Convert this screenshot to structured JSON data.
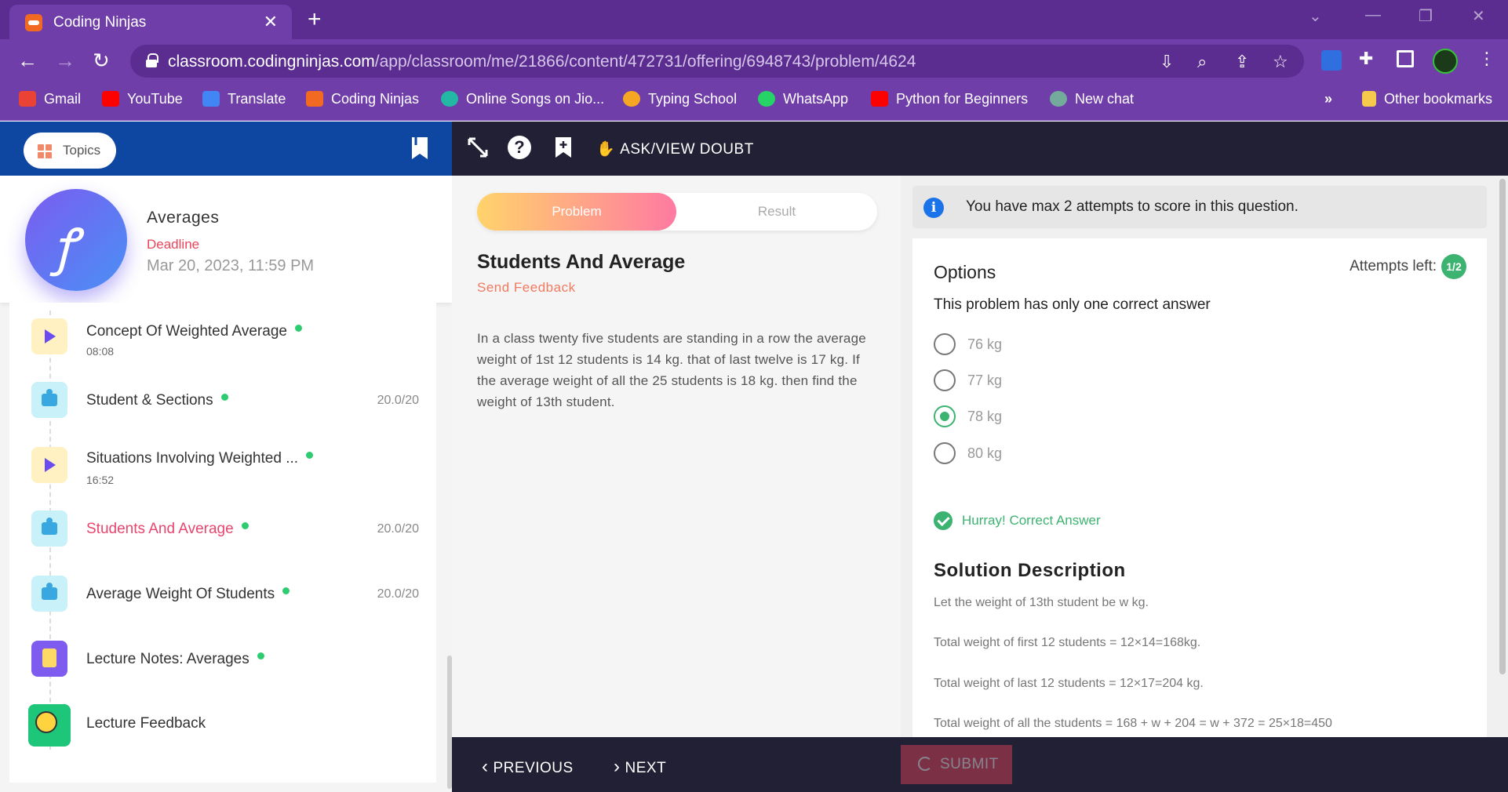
{
  "browser": {
    "tab_title": "Coding Ninjas",
    "tab_close": "✕",
    "new_tab": "+",
    "url_domain": "classroom.codingninjas.com",
    "url_path": "/app/classroom/me/21866/content/472731/offering/6948743/problem/4624",
    "bookmarks": [
      {
        "label": "Gmail",
        "color": "#ea4335"
      },
      {
        "label": "YouTube",
        "color": "#ff0000"
      },
      {
        "label": "Translate",
        "color": "#4285f4"
      },
      {
        "label": "Coding Ninjas",
        "color": "#f26a21"
      },
      {
        "label": "Online Songs on Jio...",
        "color": "#22b8a4"
      },
      {
        "label": "Typing School",
        "color": "#f5a623"
      },
      {
        "label": "WhatsApp",
        "color": "#25d366"
      },
      {
        "label": "Python for Beginners",
        "color": "#ff0000"
      },
      {
        "label": "New chat",
        "color": "#74aa9c"
      }
    ],
    "bookmarks_more": "»",
    "other_bookmarks": "Other bookmarks"
  },
  "sidebar": {
    "topics_label": "Topics",
    "course_logo_glyph": "ꝭ",
    "course_title": "Averages",
    "deadline_label": "Deadline",
    "deadline_date": "Mar 20, 2023, 11:59 PM",
    "items": [
      {
        "label": "Concept Of Weighted Average",
        "sub": "08:08",
        "score": "",
        "icon": "video-icon"
      },
      {
        "label": "Student & Sections",
        "sub": "",
        "score": "20.0/20",
        "icon": "puzzle-icon"
      },
      {
        "label": "Situations Involving Weighted ...",
        "sub": "16:52",
        "score": "",
        "icon": "video-icon"
      },
      {
        "label": "Students And Average",
        "sub": "",
        "score": "20.0/20",
        "icon": "puzzle-icon"
      },
      {
        "label": "Average Weight Of Students",
        "sub": "",
        "score": "20.0/20",
        "icon": "puzzle-icon"
      },
      {
        "label": "Lecture Notes: Averages",
        "sub": "",
        "score": "",
        "icon": "notes-icon"
      },
      {
        "label": "Lecture Feedback",
        "sub": "",
        "score": "",
        "icon": "feedback-icon"
      }
    ]
  },
  "toolbar": {
    "doubt_label": "ASK/VIEW DOUBT"
  },
  "problem": {
    "tab_problem": "Problem",
    "tab_result": "Result",
    "title": "Students And Average",
    "send_feedback": "Send Feedback",
    "text": "In a class twenty five students are standing in a row the average weight of 1st 12 students is 14 kg. that of last twelve is 17 kg. If the average weight of all the 25 students is 18 kg. then find the weight of 13th student."
  },
  "answer": {
    "info": "You have max 2 attempts to score in this question.",
    "options_title": "Options",
    "attempts_label": "Attempts left:",
    "attempts_value": "1/2",
    "note": "This problem has only one correct answer",
    "options": [
      "76 kg",
      "77 kg",
      "78 kg",
      "80 kg"
    ],
    "selected": "78 kg",
    "result": "Hurray! Correct Answer",
    "solution_title": "Solution Description",
    "solution_lines": [
      "Let the weight of 13th student be w kg.",
      "Total weight of first 12 students = 12×14=168kg.",
      "Total weight of last 12 students = 12×17=204 kg.",
      "Total weight of all the students = 168 + w + 204 = w + 372 = 25×18=450"
    ]
  },
  "footer": {
    "previous": "PREVIOUS",
    "next": "NEXT",
    "submit": "SUBMIT"
  },
  "colors": {
    "browser_purple": "#6f3ea8",
    "header_blue": "#0d47a1",
    "toolbar_dark": "#222034",
    "accent_pink": "#e8456e",
    "success_green": "#3cb371"
  }
}
